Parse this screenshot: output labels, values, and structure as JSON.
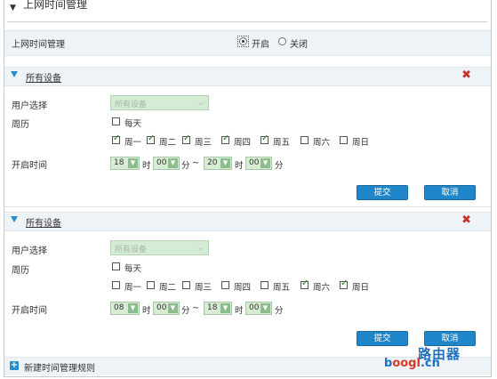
{
  "page": {
    "title": "上网时间管理"
  },
  "main_toggle": {
    "label": "上网时间管理",
    "on_label": "开启",
    "off_label": "关闭",
    "selected": "on"
  },
  "rules": [
    {
      "header": "所有设备",
      "user_label": "用户选择",
      "user_value": "所有设备",
      "calendar_label": "周历",
      "everyday_label": "每天",
      "everyday_checked": false,
      "days": [
        {
          "label": "周一",
          "checked": true
        },
        {
          "label": "周二",
          "checked": true
        },
        {
          "label": "周三",
          "checked": true
        },
        {
          "label": "周四",
          "checked": true
        },
        {
          "label": "周五",
          "checked": true
        },
        {
          "label": "周六",
          "checked": false
        },
        {
          "label": "周日",
          "checked": false
        }
      ],
      "time_label": "开启时间",
      "start_hour": "18",
      "start_min": "00",
      "end_hour": "20",
      "end_min": "00",
      "hour_unit": "时",
      "min_unit": "分",
      "tilde": "~",
      "submit": "提交",
      "cancel": "取消"
    },
    {
      "header": "所有设备",
      "user_label": "用户选择",
      "user_value": "所有设备",
      "calendar_label": "周历",
      "everyday_label": "每天",
      "everyday_checked": false,
      "days": [
        {
          "label": "周一",
          "checked": false
        },
        {
          "label": "周二",
          "checked": false
        },
        {
          "label": "周三",
          "checked": false
        },
        {
          "label": "周四",
          "checked": false
        },
        {
          "label": "周五",
          "checked": false
        },
        {
          "label": "周六",
          "checked": true
        },
        {
          "label": "周日",
          "checked": true
        }
      ],
      "time_label": "开启时间",
      "start_hour": "08",
      "start_min": "00",
      "end_hour": "18",
      "end_min": "00",
      "hour_unit": "时",
      "min_unit": "分",
      "tilde": "~",
      "submit": "提交",
      "cancel": "取消"
    }
  ],
  "footer": {
    "add_label": "新建时间管理规则"
  },
  "watermark": {
    "line1": "路由器",
    "line2_a": "b",
    "line2_b": "oogl",
    "line2_c": ".cn"
  },
  "colors": {
    "accent": "#1f86c9",
    "delete": "#c8322a",
    "check": "#1e7d1e"
  }
}
